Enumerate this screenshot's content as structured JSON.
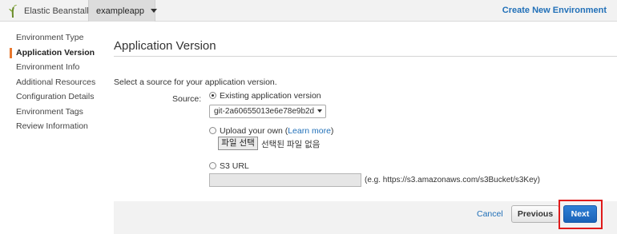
{
  "topbar": {
    "brand_label": "Elastic Beanstalk",
    "brand_icon": "beanstalk-logo-icon",
    "app_name": "exampleapp",
    "create_env_label": "Create New Environment"
  },
  "sidebar": {
    "items": [
      {
        "label": "Environment Type",
        "active": false
      },
      {
        "label": "Application Version",
        "active": true
      },
      {
        "label": "Environment Info",
        "active": false
      },
      {
        "label": "Additional Resources",
        "active": false
      },
      {
        "label": "Configuration Details",
        "active": false
      },
      {
        "label": "Environment Tags",
        "active": false
      },
      {
        "label": "Review Information",
        "active": false
      }
    ]
  },
  "main": {
    "title": "Application Version",
    "intro": "Select a source for your application version.",
    "source_label": "Source:",
    "options": {
      "existing": {
        "label": "Existing application version",
        "checked": true,
        "selected_version": "git-2a60655013e6e78e9b2d"
      },
      "upload": {
        "label": "Upload your own (",
        "link": "Learn more",
        "suffix": ")",
        "checked": false,
        "file_button": "파일 선택",
        "file_status": "선택된 파일 없음"
      },
      "s3": {
        "label": "S3 URL",
        "checked": false,
        "value": "",
        "hint": "(e.g. https://s3.amazonaws.com/s3Bucket/s3Key)"
      }
    }
  },
  "footer": {
    "cancel_label": "Cancel",
    "previous_label": "Previous",
    "next_label": "Next"
  },
  "colors": {
    "accent_link": "#2170b8",
    "active_marker": "#e8772e",
    "primary_button": "#1a63b8",
    "highlight": "#e01b1b"
  }
}
